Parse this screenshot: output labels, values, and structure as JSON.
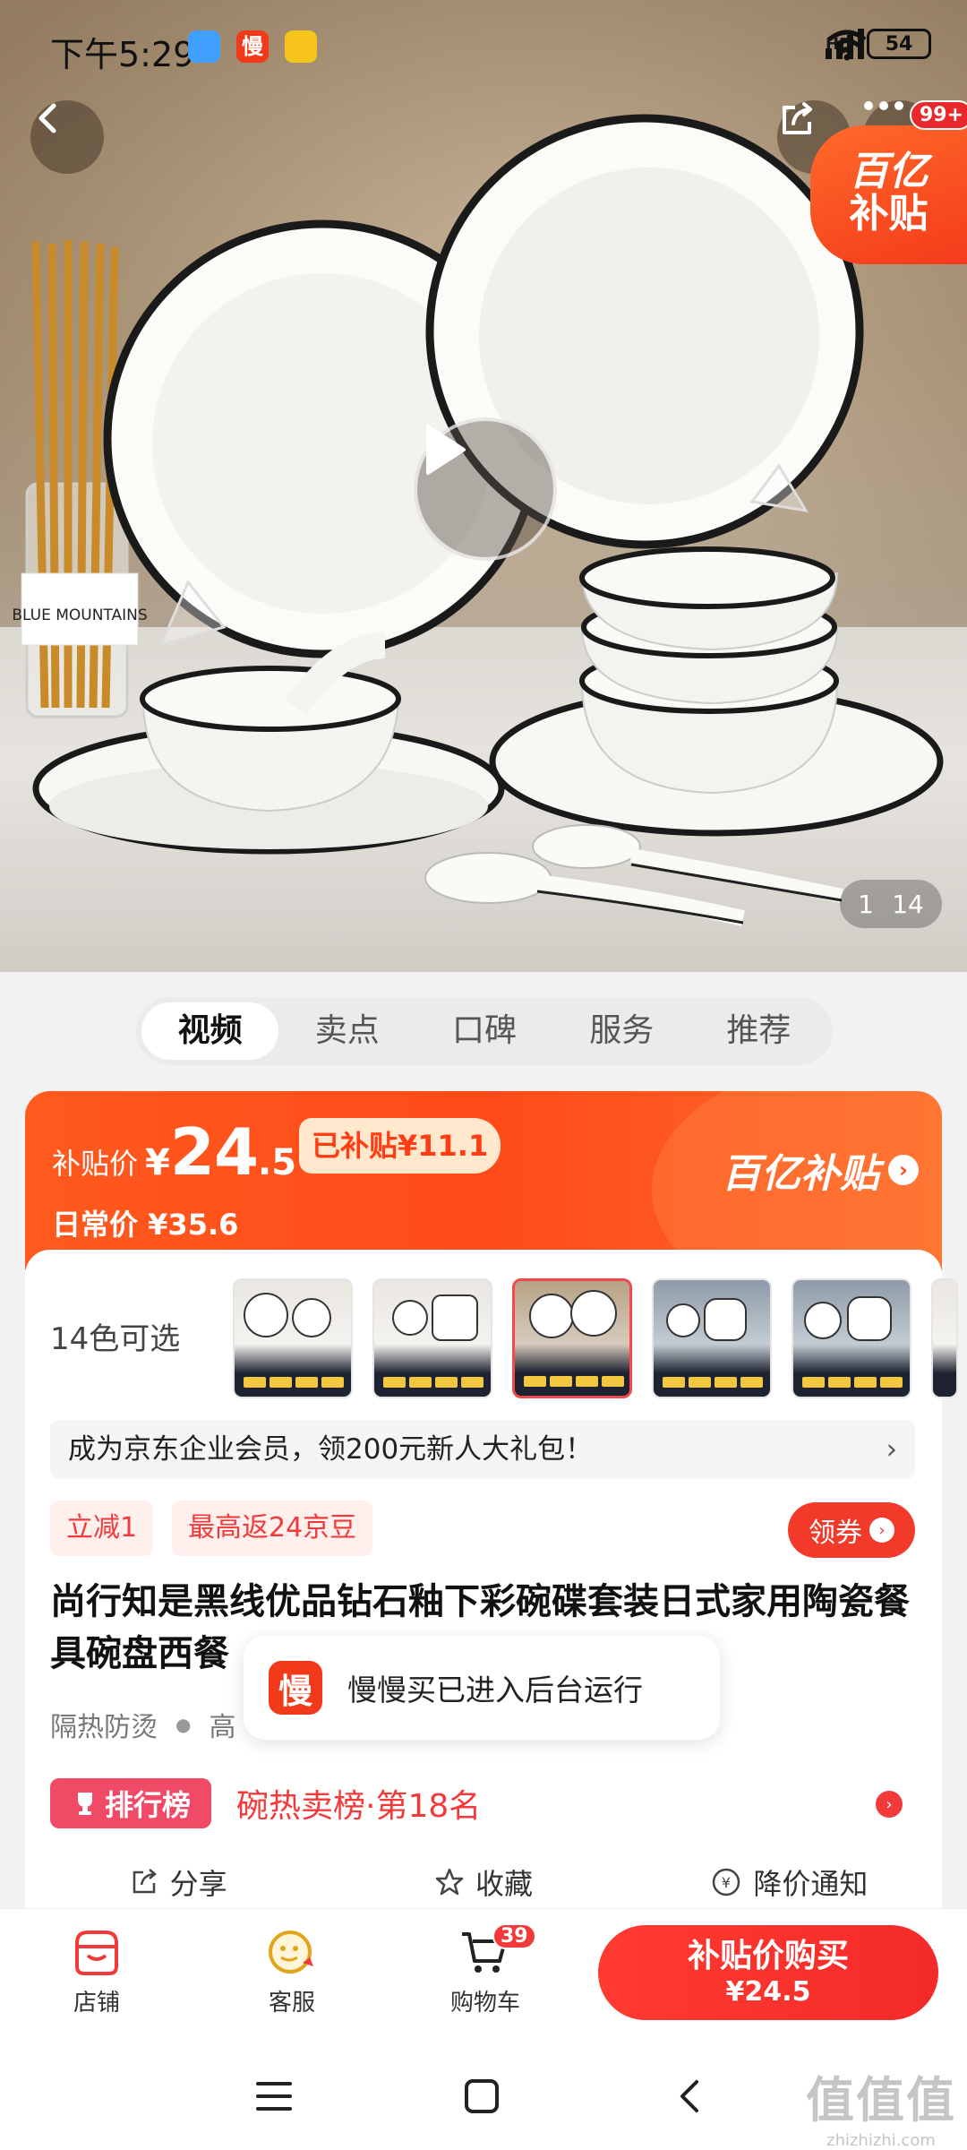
{
  "status_bar": {
    "time": "下午5:29",
    "battery": "54",
    "network": "HD"
  },
  "hero": {
    "image_subject": "white ceramic dinnerware set with black rim",
    "label_text": "BLUE MOUNTAINS",
    "badge_count": "99+",
    "corner_badge": {
      "line1": "百亿",
      "line2": "补贴"
    },
    "page_current": "1",
    "page_total": "14"
  },
  "tabs": [
    {
      "label": "视频",
      "active": true
    },
    {
      "label": "卖点",
      "active": false
    },
    {
      "label": "口碑",
      "active": false
    },
    {
      "label": "服务",
      "active": false
    },
    {
      "label": "推荐",
      "active": false
    }
  ],
  "price": {
    "label": "补贴价",
    "currency": "¥",
    "integer": "24",
    "decimal": ".5",
    "subsidy_chip": "已补贴¥11.1",
    "daily_label": "日常价",
    "daily_price": "¥35.6",
    "brand": "百亿补贴",
    "brand_arrow": "›"
  },
  "product": {
    "colors_label": "14色可选",
    "vip_banner": "成为京东企业会员，领200元新人大礼包！",
    "vip_chevron": "›",
    "tags": [
      "立减1",
      "最高返24京豆"
    ],
    "coupon_label": "领券",
    "title": "尚行知是黑线优品钻石釉下彩碗碟套装日式家用陶瓷餐具碗盘西餐",
    "features": [
      "隔热防烫",
      "高"
    ],
    "rank_badge": "排行榜",
    "rank_text": "碗热卖榜·第18名",
    "actions": [
      {
        "label": "分享",
        "icon": "share-icon"
      },
      {
        "label": "收藏",
        "icon": "star-icon"
      },
      {
        "label": "降价通知",
        "icon": "price-drop-icon"
      }
    ]
  },
  "toast": {
    "icon_char": "慢",
    "text": "慢慢买已进入后台运行"
  },
  "bottom_bar": {
    "shop": "店铺",
    "service": "客服",
    "cart": "购物车",
    "cart_count": "39",
    "buy_line1": "补贴价购买",
    "buy_line2": "¥24.5"
  },
  "watermark": {
    "line1": "值值值",
    "line2": "zhizhizhi.com"
  },
  "colors": {
    "accent_red": "#f23a3a",
    "subsidy_orange": "#ff4a1a"
  }
}
